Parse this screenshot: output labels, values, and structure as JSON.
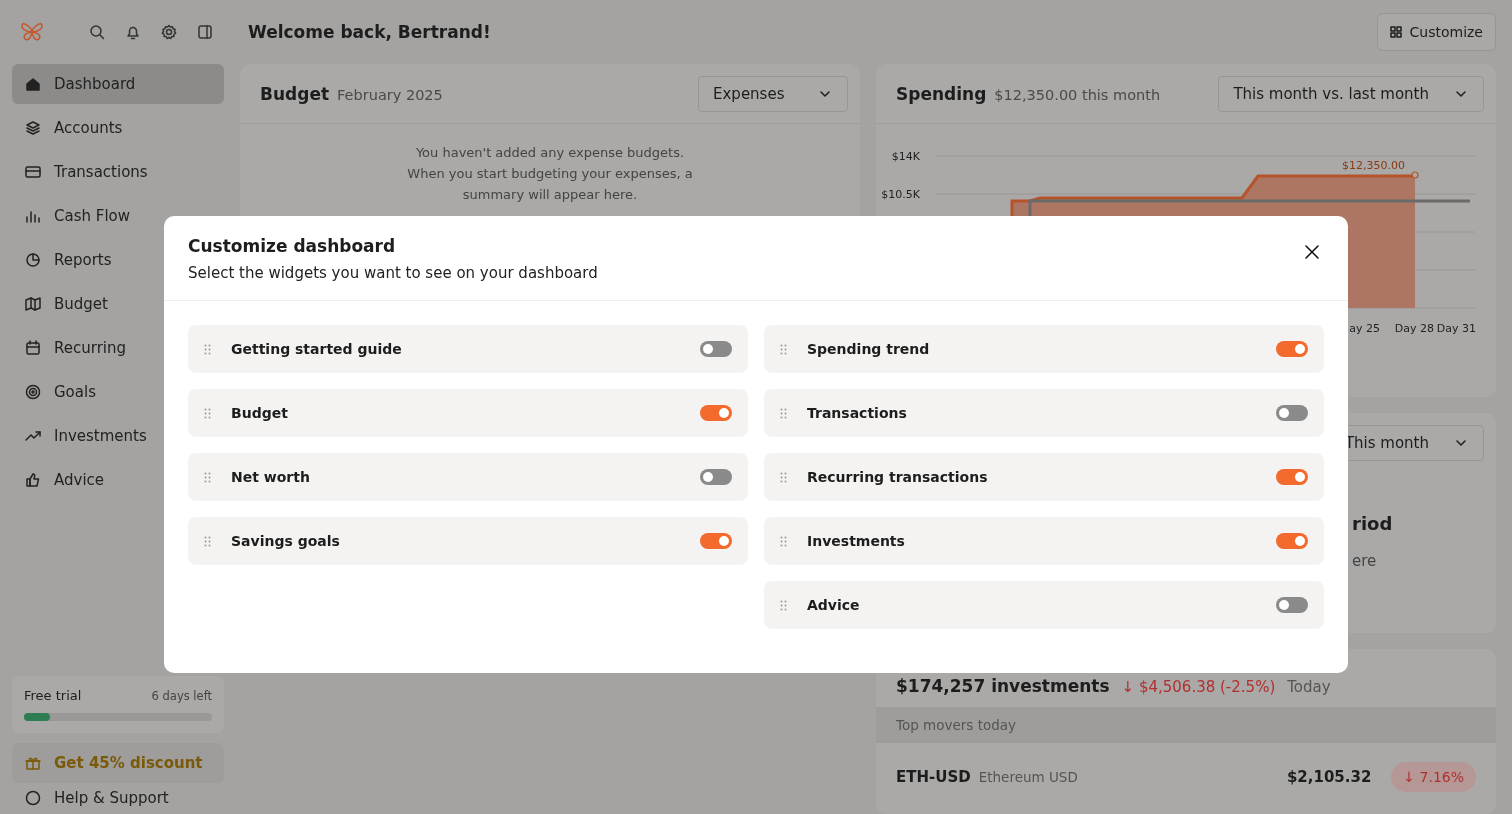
{
  "header": {
    "greeting": "Welcome back, Bertrand!",
    "customize_button": "Customize"
  },
  "sidebar": {
    "items": [
      {
        "label": "Dashboard",
        "selected": true
      },
      {
        "label": "Accounts",
        "selected": false
      },
      {
        "label": "Transactions",
        "selected": false
      },
      {
        "label": "Cash Flow",
        "selected": false
      },
      {
        "label": "Reports",
        "selected": false
      },
      {
        "label": "Budget",
        "selected": false
      },
      {
        "label": "Recurring",
        "selected": false
      },
      {
        "label": "Goals",
        "selected": false
      },
      {
        "label": "Investments",
        "selected": false
      },
      {
        "label": "Advice",
        "selected": false
      }
    ],
    "trial": {
      "label": "Free trial",
      "remaining": "6 days left",
      "level": 0.14
    },
    "discount_button": "Get 45% discount",
    "help": "Help & Support"
  },
  "budget_card": {
    "title": "Budget",
    "period": "February 2025",
    "dropdown": "Expenses",
    "message": "You haven't added any expense budgets. When you start budgeting your expenses, a summary will appear here."
  },
  "spending_card": {
    "title": "Spending",
    "summary": "$12,350.00 this month",
    "dropdown": "This month vs. last month",
    "y_labels": [
      "$14K",
      "$10.5K"
    ],
    "x_labels": [
      "ay 25",
      "Day 28",
      "Day 31"
    ],
    "annotation": "$12,350.00"
  },
  "period_card": {
    "dropdown": "This month",
    "heading": "riod",
    "text": "ere"
  },
  "investments_card": {
    "total": "$174,257 investments",
    "change": "↓ $4,506.38 (-2.5%)",
    "period": "Today",
    "movers_title": "Top movers today",
    "movers": [
      {
        "symbol": "ETH-USD",
        "name": "Ethereum USD",
        "price": "$2,105.32",
        "change": "↓ 7.16%",
        "down": true
      }
    ]
  },
  "modal": {
    "title": "Customize dashboard",
    "subtitle": "Select the widgets you want to see on your dashboard",
    "columns": [
      {
        "widgets": [
          {
            "label": "Getting started guide",
            "on": false
          },
          {
            "label": "Budget",
            "on": true
          },
          {
            "label": "Net worth",
            "on": false
          },
          {
            "label": "Savings goals",
            "on": true
          }
        ]
      },
      {
        "widgets": [
          {
            "label": "Spending trend",
            "on": true
          },
          {
            "label": "Transactions",
            "on": false
          },
          {
            "label": "Recurring transactions",
            "on": true
          },
          {
            "label": "Investments",
            "on": true
          },
          {
            "label": "Advice",
            "on": false
          }
        ]
      }
    ]
  }
}
